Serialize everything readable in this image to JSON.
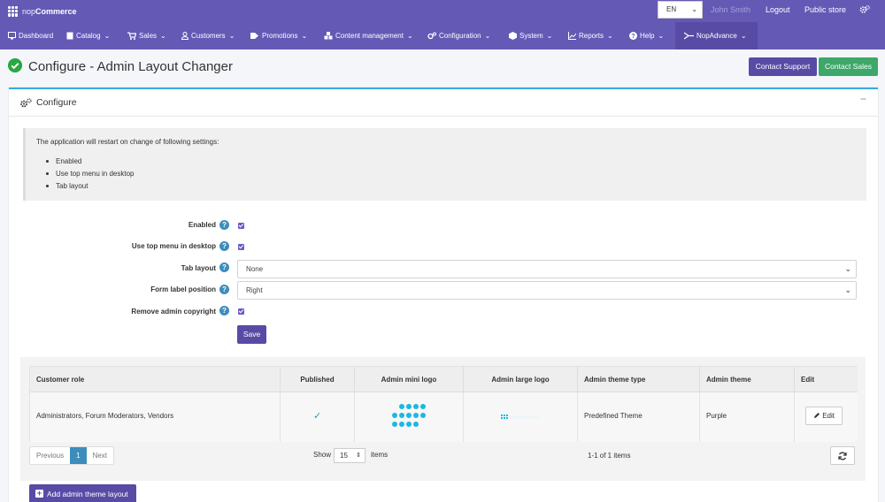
{
  "topbar": {
    "brand_light": "nop",
    "brand_bold": "Commerce",
    "language": "EN",
    "user": "John Smith",
    "logout": "Logout",
    "public_store": "Public store",
    "settings_icon": "gear-icon"
  },
  "nav": [
    {
      "label": "Dashboard",
      "icon": "monitor-icon",
      "has_caret": false
    },
    {
      "label": "Catalog",
      "icon": "book-icon",
      "has_caret": true
    },
    {
      "label": "Sales",
      "icon": "cart-icon",
      "has_caret": true
    },
    {
      "label": "Customers",
      "icon": "user-icon",
      "has_caret": true
    },
    {
      "label": "Promotions",
      "icon": "tag-icon",
      "has_caret": true
    },
    {
      "label": "Content management",
      "icon": "cubes-icon",
      "has_caret": true
    },
    {
      "label": "Configuration",
      "icon": "gears-icon",
      "has_caret": true
    },
    {
      "label": "System",
      "icon": "cube-icon",
      "has_caret": true
    },
    {
      "label": "Reports",
      "icon": "chart-icon",
      "has_caret": true
    },
    {
      "label": "Help",
      "icon": "question-icon",
      "has_caret": true
    },
    {
      "label": "NopAdvance",
      "icon": "plugin-icon",
      "has_caret": true
    }
  ],
  "header": {
    "title": "Configure - Admin Layout Changer",
    "contact_support": "Contact Support",
    "contact_sales": "Contact Sales"
  },
  "card": {
    "title": "Configure",
    "collapse": "−"
  },
  "callout": {
    "text": "The application will restart on change of following settings:",
    "items": [
      "Enabled",
      "Use top menu in desktop",
      "Tab layout"
    ]
  },
  "form": {
    "enabled_label": "Enabled",
    "top_menu_label": "Use top menu in desktop",
    "tab_layout_label": "Tab layout",
    "tab_layout_value": "None",
    "form_label_position_label": "Form label position",
    "form_label_position_value": "Right",
    "remove_copyright_label": "Remove admin copyright",
    "help_glyph": "?",
    "save": "Save"
  },
  "table": {
    "columns": [
      "Customer role",
      "Published",
      "Admin mini logo",
      "Admin large logo",
      "Admin theme type",
      "Admin theme",
      "Edit"
    ],
    "rows": [
      {
        "customer_role": "Administrators, Forum Moderators, Vendors",
        "published": "✓",
        "theme_type": "Predefined Theme",
        "theme": "Purple",
        "edit": "Edit"
      }
    ]
  },
  "pager": {
    "previous": "Previous",
    "current": "1",
    "next": "Next",
    "show_label": "Show",
    "page_size": "15",
    "items_label": "items",
    "count": "1-1 of 1 items"
  },
  "footer": {
    "add_button": "Add admin theme layout"
  },
  "colors": {
    "brand": "#6559b6",
    "accent": "#584ba5",
    "success": "#3ea76a",
    "info": "#3c8dbc",
    "logo": "#1cb7e4"
  }
}
